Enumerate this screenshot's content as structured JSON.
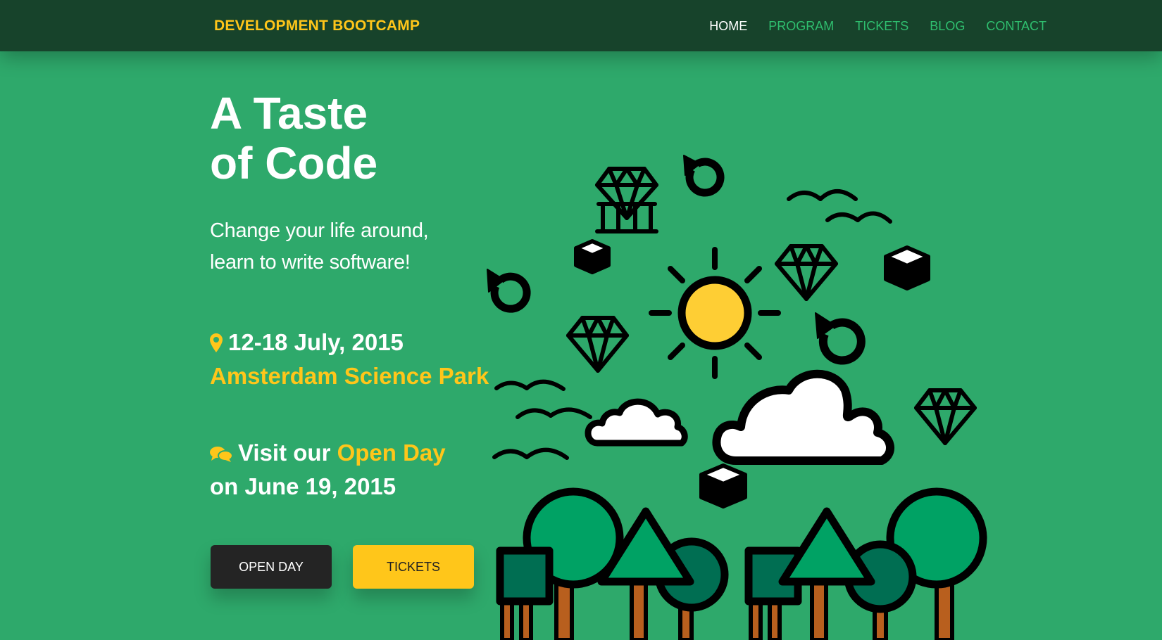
{
  "nav": {
    "brand": "DEVELOPMENT BOOTCAMP",
    "items": [
      {
        "label": "HOME",
        "active": true
      },
      {
        "label": "PROGRAM",
        "active": false
      },
      {
        "label": "TICKETS",
        "active": false
      },
      {
        "label": "BLOG",
        "active": false
      },
      {
        "label": "CONTACT",
        "active": false
      }
    ]
  },
  "hero": {
    "title_line1": "A Taste",
    "title_line2": "of Code",
    "subtitle_line1": "Change your life around,",
    "subtitle_line2": "learn to write software!",
    "date": "12-18 July, 2015",
    "location": "Amsterdam Science Park",
    "openday_prefix": "Visit our",
    "openday_highlight": "Open Day",
    "openday_date": "on June 19, 2015"
  },
  "buttons": {
    "open_day": "OPEN DAY",
    "tickets": "TICKETS"
  },
  "icons": {
    "location": "map-marker-icon",
    "chat": "chat-bubbles-icon"
  },
  "colors": {
    "background": "#2ea96b",
    "navbar": "#17432b",
    "accent_yellow": "#ffc61a",
    "nav_link": "#2fbf6f",
    "button_dark": "#242424"
  }
}
